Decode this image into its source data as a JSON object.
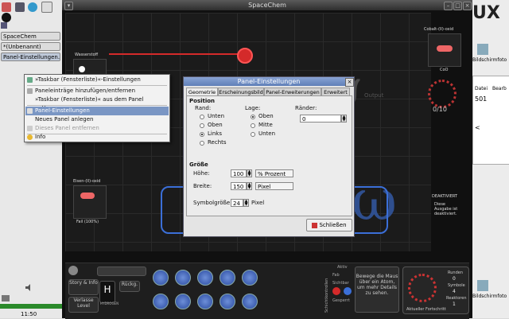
{
  "taskbar": {
    "buttons": [
      "SpaceChem",
      "*(Unbenannt)",
      "Panel-Einstellungen..."
    ],
    "clock": "11:50"
  },
  "game": {
    "title": "SpaceChem",
    "labels": {
      "wasserstoff": "Wasserstoff",
      "eisen": "Eisen-(II)-oxid",
      "fail": "Fail (100%)",
      "cobalt": "Cobalt-(II)-oxid",
      "coo": "CoO",
      "counter": "0/10",
      "output": "Output",
      "deaktiviert": "DEAKTIVIERT",
      "deaktiviert_desc": "Diese Ausgabe ist deaktiviert."
    },
    "bottom": {
      "story": "Story & Info",
      "verlasse": "Verlasse Level",
      "rueckg": "Rückg.",
      "hydrogen": "H",
      "hydrogen_sub": "HYDROGEN",
      "schichtkontrollen": "Schichtkontrollen",
      "aktiv": "Aktiv",
      "fab": "Fab",
      "sichtbar": "Sichtbar",
      "gesperrt": "Gesperrt",
      "hint": "Bewege die Maus über ein Atom, um mehr Details zu sehen.",
      "runden_label": "Runden",
      "runden_val": "0",
      "symbole_label": "Symbole",
      "symbole_val": "4",
      "reaktoren_label": "Reaktoren",
      "reaktoren_val": "1",
      "fortschritt": "Aktueller Fortschritt"
    }
  },
  "rightside": {
    "linux_text": "UX",
    "bildschirm1": "Bildschirmfoto",
    "menu_datei": "Datei",
    "menu_bearb": "Bearb",
    "num": "501",
    "lt": "<",
    "bildschirm2": "Bildschirmfoto"
  },
  "context_menu": {
    "items": [
      {
        "label": "»Taskbar (Fensterliste)«-Einstellungen",
        "state": "normal"
      },
      {
        "label": "Paneleinträge hinzufügen/entfernen",
        "state": "normal"
      },
      {
        "label": "»Taskbar (Fensterliste)« aus dem Panel entfernen",
        "state": "normal"
      },
      {
        "label": "Panel-Einstellungen",
        "state": "highlighted"
      },
      {
        "label": "Neues Panel anlegen",
        "state": "normal"
      },
      {
        "label": "Dieses Panel entfernen",
        "state": "disabled"
      },
      {
        "label": "Info",
        "state": "normal"
      }
    ]
  },
  "dialog": {
    "title": "Panel-Einstellungen",
    "tabs": [
      "Geometrie",
      "Erscheinungsbild",
      "Panel-Erweiterungen",
      "Erweitert"
    ],
    "selected_tab": "Geometrie",
    "position": {
      "heading": "Position",
      "rand_label": "Rand:",
      "rand_options": [
        "Unten",
        "Oben",
        "Links",
        "Rechts"
      ],
      "rand_selected": "Links",
      "lage_label": "Lage:",
      "lage_options": [
        "Oben",
        "Mitte",
        "Unten"
      ],
      "lage_selected": "Oben",
      "raender_label": "Ränder:",
      "raender_value": "0"
    },
    "groesse": {
      "heading": "Größe",
      "hoehe_label": "Höhe:",
      "hoehe_value": "100",
      "hoehe_unit": "% Prozent",
      "breite_label": "Breite:",
      "breite_value": "150",
      "breite_unit": "Pixel",
      "symbol_label": "Symbolgröße:",
      "symbol_value": "24",
      "symbol_unit": "Pixel"
    },
    "close_label": "Schließen"
  },
  "colors": {
    "accent_red": "#d42a2a",
    "blue_glow": "#3b6fd8",
    "dialog_title": "#6d8cc4",
    "menu_highlight": "#7a96c4"
  }
}
